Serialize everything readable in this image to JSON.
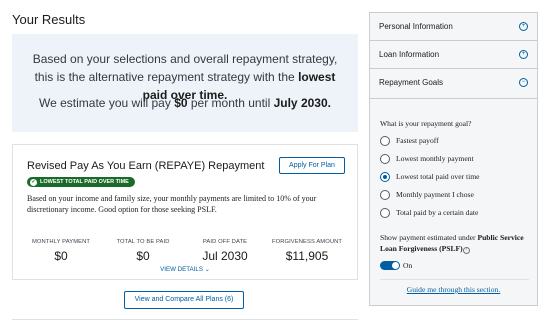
{
  "page": {
    "title": "Your Results"
  },
  "summary": {
    "line1_pre": "Based on your selections and overall repayment strategy, this is the alternative repayment strategy with the ",
    "line1_bold": "lowest paid over time.",
    "line2_pre": "We estimate you will pay ",
    "amount": "$0",
    "line2_mid": " per month until ",
    "until": "July 2030."
  },
  "plan": {
    "title": "Revised Pay As You Earn (REPAYE) Repayment",
    "apply_label": "Apply For Plan",
    "badge": "LOWEST TOTAL PAID OVER TIME",
    "description": "Based on your income and family size, your monthly payments are limited to 10% of your discretionary income. Good option for those seeking PSLF.",
    "metrics": [
      {
        "label": "MONTHLY PAYMENT",
        "value": "$0"
      },
      {
        "label": "TOTAL TO BE PAID",
        "value": "$0"
      },
      {
        "label": "PAID OFF DATE",
        "value": "Jul 2030"
      },
      {
        "label": "FORGIVENESS AMOUNT",
        "value": "$11,905"
      }
    ],
    "view_details": "VIEW DETAILS"
  },
  "compare_button": "View and Compare All Plans (6)",
  "side": {
    "accordions": [
      {
        "label": "Personal Information",
        "icon": "plus-circle-icon"
      },
      {
        "label": "Loan Information",
        "icon": "plus-circle-icon"
      },
      {
        "label": "Repayment Goals",
        "icon": "minus-circle-icon"
      }
    ],
    "question": "What is your repayment goal?",
    "options": [
      {
        "label": "Fastest payoff",
        "selected": false
      },
      {
        "label": "Lowest monthly payment",
        "selected": false
      },
      {
        "label": "Lowest total paid over time",
        "selected": true
      },
      {
        "label": "Monthly payment I chose",
        "selected": false
      },
      {
        "label": "Total paid by a certain date",
        "selected": false
      }
    ],
    "pslf_pre": "Show payment estimated under ",
    "pslf_bold": "Public Service Loan Forgiveness (PSLF)",
    "toggle_label": "On",
    "toggle_on": true,
    "guide_link": "Guide me through this section."
  },
  "colors": {
    "accent": "#005ea2",
    "badge": "#1a6b2a",
    "summary_bg": "#edf3f8",
    "panel_bg": "#f5f6f7"
  }
}
